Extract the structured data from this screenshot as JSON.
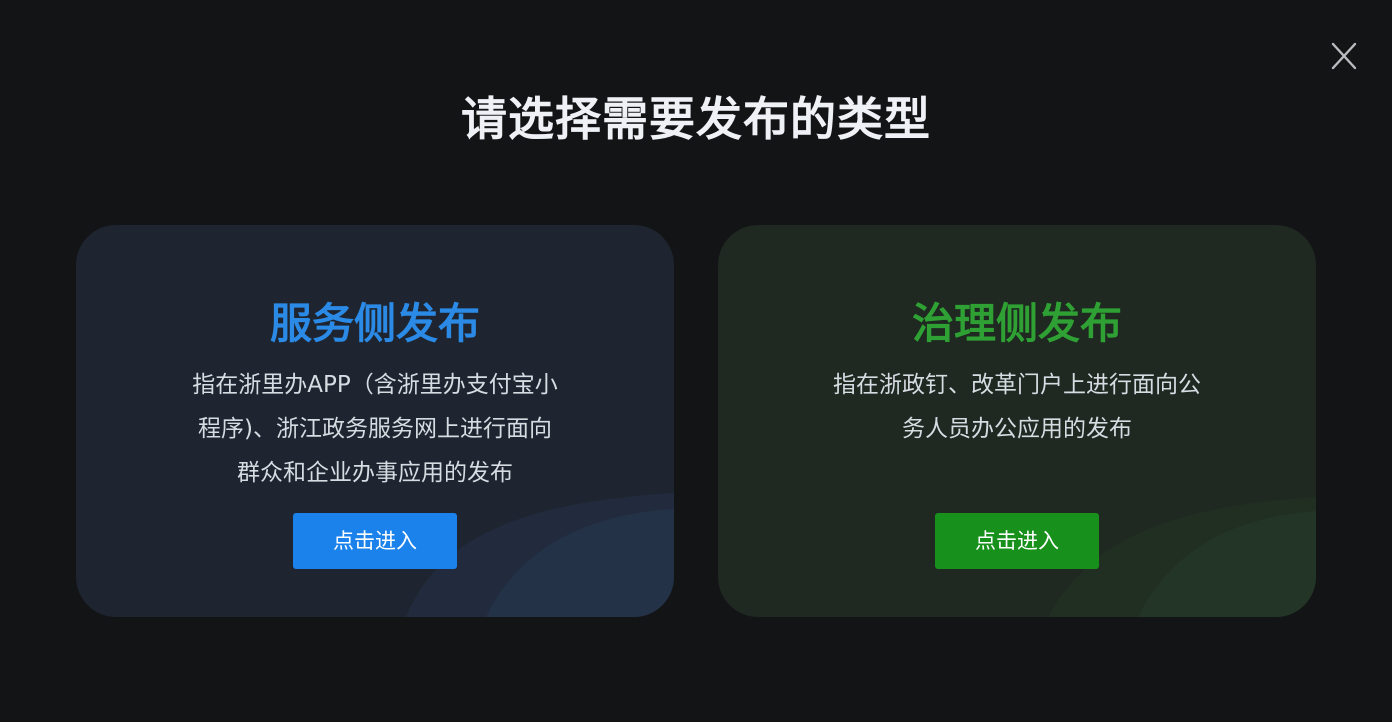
{
  "dialog": {
    "title": "请选择需要发布的类型",
    "close_icon": "close-icon"
  },
  "cards": [
    {
      "title": "服务侧发布",
      "description_lines": [
        "指在浙里办APP（含浙里办支付宝小",
        "程序)、浙江政务服务网上进行面向",
        "群众和企业办事应用的发布"
      ],
      "button_label": "点击进入",
      "title_color": "#2b8ae6",
      "button_color": "#1a82ea"
    },
    {
      "title": "治理侧发布",
      "description_lines": [
        "指在浙政钉、改革门户上进行面向公",
        "务人员办公应用的发布"
      ],
      "button_label": "点击进入",
      "title_color": "#2fa033",
      "button_color": "#17901c"
    }
  ]
}
